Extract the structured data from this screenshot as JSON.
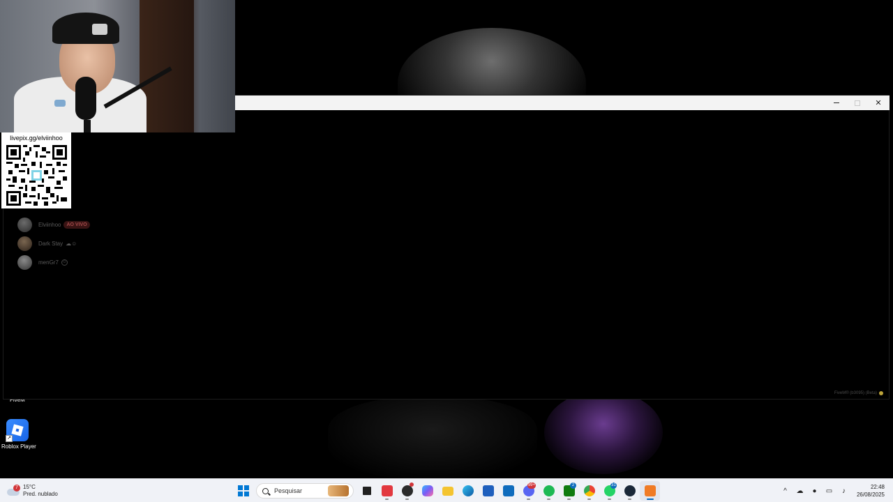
{
  "desktop": {
    "icons": [
      {
        "label": "FiveM",
        "icon": "fivem-icon"
      },
      {
        "label": "Roblox Player",
        "icon": "roblox-icon"
      }
    ]
  },
  "webcam_overlay": {
    "donation_label": "livepix.gg/elviinhoo",
    "qr_icon": "qr-code-icon"
  },
  "app_window": {
    "controls": {
      "minimize": "–",
      "maximize": "□",
      "close": "✕"
    },
    "servers": [
      {
        "name": "Elviinhoo",
        "badge": "AO VIVO"
      },
      {
        "name": "Dark Stay",
        "suffix": "☁☺"
      },
      {
        "name": "menGr7",
        "suffix": "☺"
      }
    ],
    "version": "FiveM® (b3095) (Beta)"
  },
  "taskbar": {
    "weather": {
      "temperature": "15°C",
      "condition": "Pred. nublado",
      "badge": "7"
    },
    "search": {
      "placeholder": "Pesquisar"
    },
    "apps": [
      {
        "name": "start",
        "icon": "windows-start-icon",
        "color": "#0078d4"
      },
      {
        "name": "task-view",
        "icon": "task-view-icon",
        "color": "#202020"
      },
      {
        "name": "anydesk",
        "icon": "anydesk-icon",
        "color": "#e2383f"
      },
      {
        "name": "obs",
        "icon": "obs-icon",
        "color": "#2b2b2b",
        "badge": ""
      },
      {
        "name": "copilot",
        "icon": "copilot-icon",
        "color": "#7b5cf5"
      },
      {
        "name": "file-explorer",
        "icon": "folder-icon",
        "color": "#f4c430"
      },
      {
        "name": "edge",
        "icon": "edge-icon",
        "color": "#1b9de2"
      },
      {
        "name": "store",
        "icon": "store-icon",
        "color": "#1e5fbd"
      },
      {
        "name": "outlook",
        "icon": "outlook-icon",
        "color": "#0f6cbd"
      },
      {
        "name": "discord",
        "icon": "discord-icon",
        "color": "#5865f2",
        "badge": "99+"
      },
      {
        "name": "spotify",
        "icon": "spotify-icon",
        "color": "#1db954"
      },
      {
        "name": "xbox",
        "icon": "xbox-icon",
        "color": "#107c10",
        "badge": "2"
      },
      {
        "name": "chrome",
        "icon": "chrome-icon",
        "color": "#ea4335"
      },
      {
        "name": "whatsapp",
        "icon": "whatsapp-icon",
        "color": "#25d366",
        "badge": "31"
      },
      {
        "name": "steam",
        "icon": "steam-icon",
        "color": "#1b2838"
      },
      {
        "name": "fivem",
        "icon": "fivem-icon",
        "color": "#f07b25"
      }
    ],
    "tray": {
      "icons": [
        "chevron-up-icon",
        "onedrive-icon",
        "microphone-icon",
        "display-icon",
        "speaker-icon"
      ],
      "time": "22:48",
      "date": "26/08/2025"
    }
  }
}
